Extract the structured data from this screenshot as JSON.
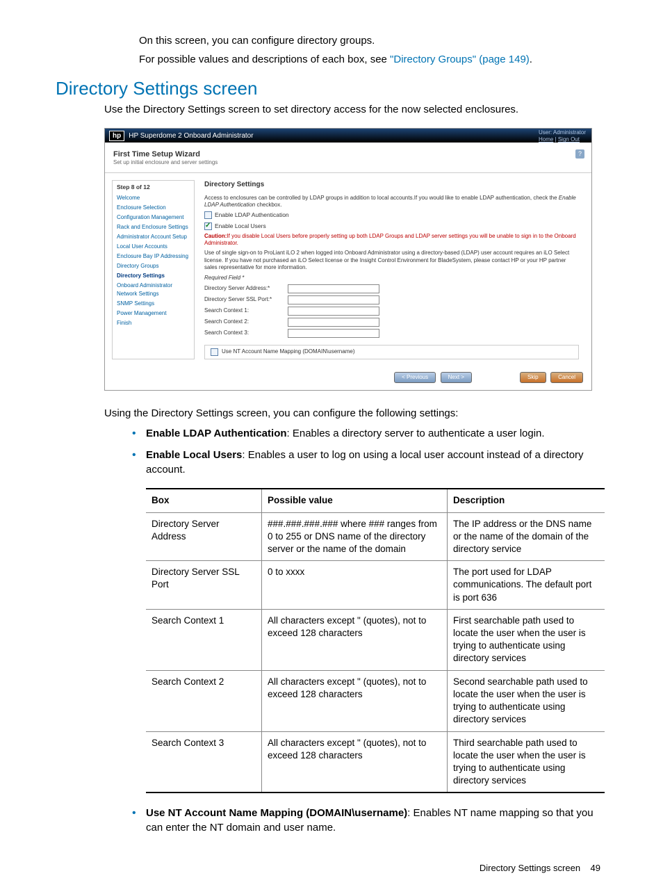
{
  "intro": {
    "line1": "On this screen, you can configure directory groups.",
    "line2a": "For possible values and descriptions of each box, see ",
    "line2link": "\"Directory Groups\" (page 149)",
    "line2b": "."
  },
  "section_title": "Directory Settings screen",
  "section_sub": "Use the Directory Settings screen to set directory access for the now selected enclosures.",
  "oa": {
    "header_title": "HP Superdome 2 Onboard Administrator",
    "user_label": "User: Administrator",
    "home": "Home",
    "signout": "Sign Out",
    "wizard_title": "First Time Setup Wizard",
    "wizard_sub": "Set up initial enclosure and server settings",
    "help": "?",
    "sidebar": {
      "step": "Step 8 of 12",
      "items": [
        "Welcome",
        "Enclosure Selection",
        "Configuration Management",
        "Rack and Enclosure Settings",
        "Administrator Account Setup",
        "Local User Accounts",
        "Enclosure Bay IP Addressing",
        "Directory Groups",
        "Directory Settings",
        "Onboard Administrator Network Settings",
        "SNMP Settings",
        "Power Management",
        "Finish"
      ]
    },
    "main": {
      "heading": "Directory Settings",
      "p1a": "Access to enclosures can be controlled by LDAP groups in addition to local accounts.If you would like to enable LDAP authentication, check the ",
      "p1ital": "Enable LDAP Authentication",
      "p1b": " checkbox.",
      "chk1": "Enable LDAP Authentication",
      "chk2": "Enable Local Users",
      "caution_label": "Caution:",
      "caution": "If you disable Local Users before properly setting up both LDAP Groups and LDAP server settings you will be unable to sign in to the Onboard Administrator.",
      "p2": "Use of single sign-on to ProLiant iLO 2 when logged into Onboard Administrator using a directory-based (LDAP) user account requires an iLO Select license. If you have not purchased an iLO Select license or the Insight Control Environment for BladeSystem, please contact HP or your HP partner sales representative for more information.",
      "req": "Required Field *",
      "f1": "Directory Server Address:*",
      "f2": "Directory Server SSL Port:*",
      "f3": "Search Context 1:",
      "f4": "Search Context 2:",
      "f5": "Search Context 3:",
      "nt": "Use NT Account Name Mapping (DOMAIN\\username)"
    },
    "buttons": {
      "prev": "< Previous",
      "next": "Next >",
      "skip": "Skip",
      "cancel": "Cancel"
    }
  },
  "post_intro": "Using the Directory Settings screen, you can configure the following settings:",
  "bullets_top": [
    {
      "bold": "Enable LDAP Authentication",
      "rest": ": Enables a directory server to authenticate a user login."
    },
    {
      "bold": "Enable Local Users",
      "rest": ": Enables a user to log on using a local user account instead of a directory account."
    }
  ],
  "table": {
    "headers": [
      "Box",
      "Possible value",
      "Description"
    ],
    "rows": [
      [
        "Directory Server Address",
        "###.###.###.### where ### ranges from 0 to 255 or DNS name of the directory server or the name of the domain",
        "The IP address or the DNS name or the name of the domain of the directory service"
      ],
      [
        "Directory Server SSL Port",
        "0 to xxxx",
        "The port used for LDAP communications. The default port is port 636"
      ],
      [
        "Search Context 1",
        "All characters except \" (quotes), not to exceed 128 characters",
        "First searchable path used to locate the user when the user is trying to authenticate using directory services"
      ],
      [
        "Search Context 2",
        "All characters except \" (quotes), not to exceed 128 characters",
        "Second searchable path used to locate the user when the user is trying to authenticate using directory services"
      ],
      [
        "Search Context 3",
        "All characters except \" (quotes), not to exceed 128 characters",
        "Third searchable path used to locate the user when the user is trying to authenticate using directory services"
      ]
    ]
  },
  "bullets_bottom": [
    {
      "bold": "Use NT Account Name Mapping (DOMAIN\\username)",
      "rest": ": Enables NT name mapping so that you can enter the NT domain and user name."
    }
  ],
  "footer": {
    "label": "Directory Settings screen",
    "page": "49"
  }
}
